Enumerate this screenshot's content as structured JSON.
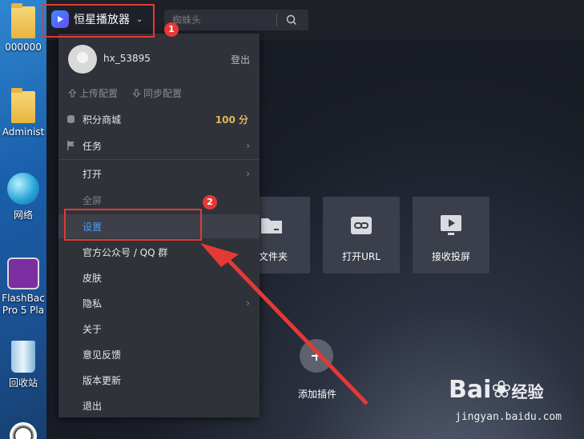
{
  "desktop": {
    "icons": [
      {
        "label": "000000"
      },
      {
        "label": "Administ"
      },
      {
        "label": "网络"
      },
      {
        "label": "FlashBac Pro 5 Pla"
      },
      {
        "label": "回收站"
      }
    ]
  },
  "app": {
    "title": "恒星播放器",
    "search_placeholder": "蜘蛛头"
  },
  "dropdown": {
    "username": "hx_53895",
    "logout": "登出",
    "upload_config": "上传配置",
    "sync_config": "同步配置",
    "points_mall": "积分商城",
    "points_value": "100 分",
    "tasks": "任务",
    "open": "打开",
    "fullscreen": "全屏",
    "settings": "设置",
    "official": "官方公众号 / QQ 群",
    "skin": "皮肤",
    "privacy": "隐私",
    "about": "关于",
    "feedback": "意见反馈",
    "update": "版本更新",
    "exit": "退出"
  },
  "tiles": {
    "open_folder": "开文件夹",
    "open_url": "打开URL",
    "receive_cast": "接收投屏"
  },
  "add_plugin": "添加插件",
  "annotations": {
    "badge1": "1",
    "badge2": "2",
    "accent": "#e53935"
  },
  "watermark": {
    "brand": "Bai",
    "brand2": "经验",
    "url": "jingyan.baidu.com"
  }
}
